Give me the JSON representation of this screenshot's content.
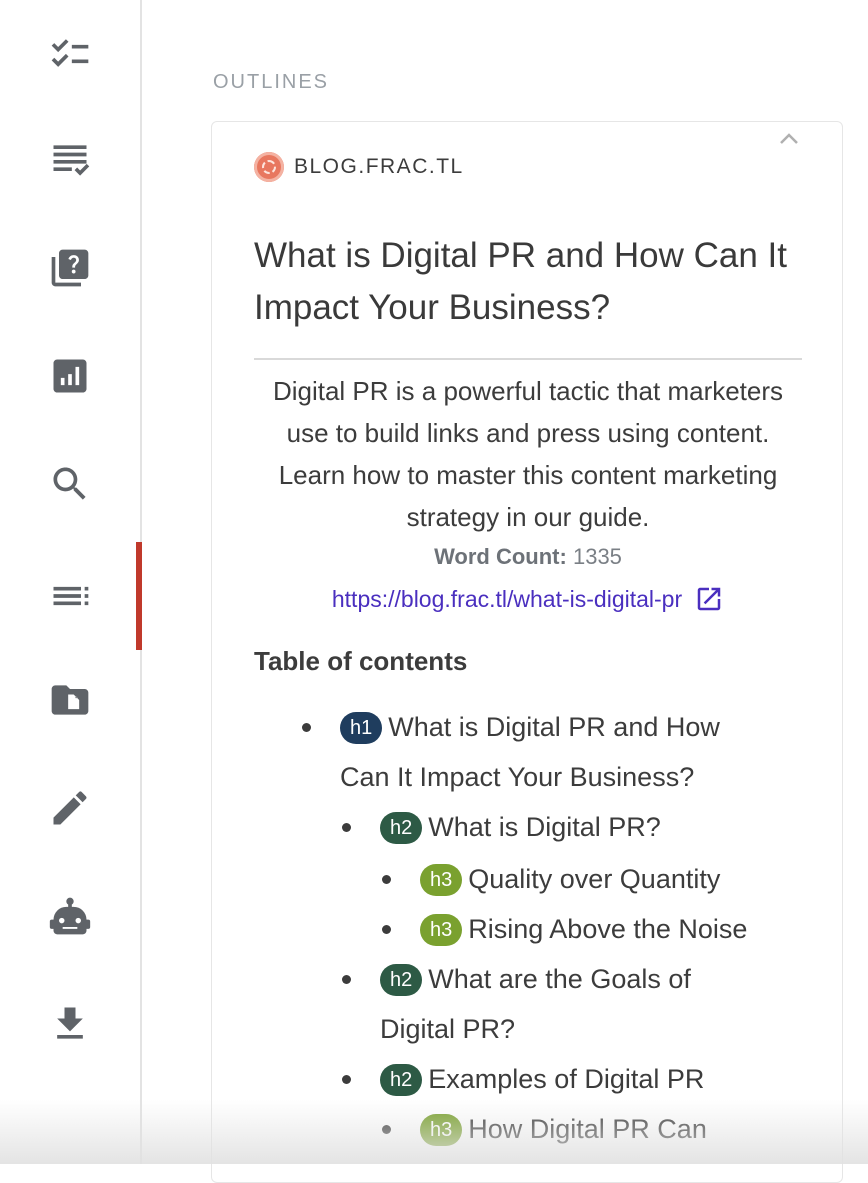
{
  "sidebar": {
    "items": [
      {
        "icon": "checklist-icon"
      },
      {
        "icon": "text-checked-icon"
      },
      {
        "icon": "question-library-icon"
      },
      {
        "icon": "chart-icon"
      },
      {
        "icon": "search-icon"
      },
      {
        "icon": "outline-list-icon",
        "active": true
      },
      {
        "icon": "folder-file-icon"
      },
      {
        "icon": "pencil-icon"
      },
      {
        "icon": "robot-icon"
      },
      {
        "icon": "download-icon"
      }
    ],
    "active_color": "#c0392b"
  },
  "section_title": "OUTLINES",
  "card": {
    "site": "BLOG.FRAC.TL",
    "title": "What is Digital PR and How Can It Impact Your Business?",
    "description": "Digital PR is a powerful tactic that marketers use to build links and press using content. Learn how to master this content marketing strategy in our guide.",
    "word_count_label": "Word Count:",
    "word_count_value": "1335",
    "url": "https://blog.frac.tl/what-is-digital-pr",
    "toc_title": "Table of contents",
    "toc": [
      {
        "level": "h1",
        "text": "What is Digital PR and How",
        "text2": "Can It Impact Your Business?"
      },
      {
        "level": "h2",
        "text": "What is Digital PR?"
      },
      {
        "level": "h3",
        "text": "Quality over Quantity"
      },
      {
        "level": "h3",
        "text": "Rising Above the Noise"
      },
      {
        "level": "h2",
        "text": "What are the Goals of",
        "text2": "Digital PR?"
      },
      {
        "level": "h2",
        "text": "Examples of Digital PR"
      },
      {
        "level": "h3",
        "text": "How Digital PR Can"
      }
    ]
  },
  "colors": {
    "h1": "#1f3d5e",
    "h2": "#2d5a45",
    "h3": "#7aa12f",
    "link": "#4a2fbf"
  }
}
